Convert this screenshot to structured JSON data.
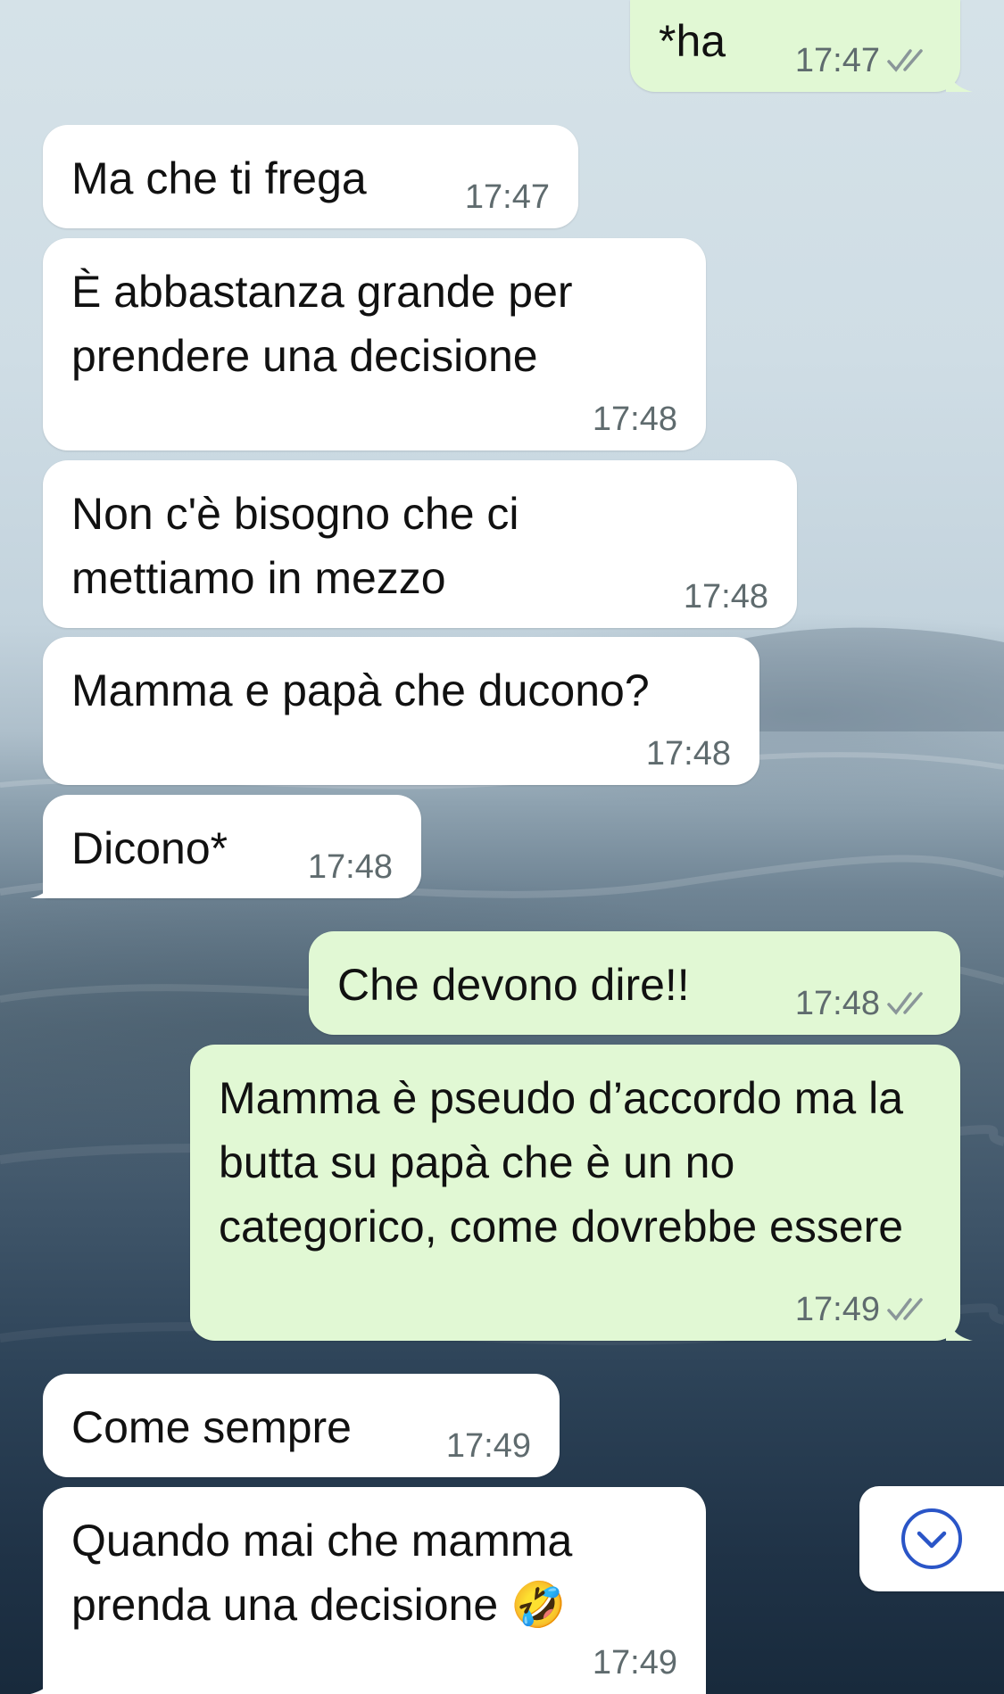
{
  "colors": {
    "incoming_bubble": "#ffffff",
    "outgoing_bubble": "#e1f8d4",
    "timestamp": "#5f6b6e",
    "read_ticks": "#8a9699",
    "scroll_button_icon": "#2a55c7"
  },
  "messages": [
    {
      "direction": "outgoing",
      "text": "*ha",
      "time": "17:47",
      "status": "read"
    },
    {
      "direction": "incoming",
      "text": "Ma che ti frega",
      "time": "17:47"
    },
    {
      "direction": "incoming",
      "text": "È abbastanza grande per prendere una decisione",
      "time": "17:48"
    },
    {
      "direction": "incoming",
      "text": "Non c'è bisogno che ci mettiamo in mezzo",
      "time": "17:48"
    },
    {
      "direction": "incoming",
      "text": "Mamma e papà che ducono?",
      "time": "17:48"
    },
    {
      "direction": "incoming",
      "text": "Dicono*",
      "time": "17:48"
    },
    {
      "direction": "outgoing",
      "text": "Che devono dire!!",
      "time": "17:48",
      "status": "read"
    },
    {
      "direction": "outgoing",
      "text": "Mamma è pseudo d’accordo ma la butta su papà che è un no categorico, come dovrebbe essere",
      "time": "17:49",
      "status": "read"
    },
    {
      "direction": "incoming",
      "text": "Come sempre",
      "time": "17:49"
    },
    {
      "direction": "incoming",
      "text": "Quando mai che mamma prenda una decisione 🤣",
      "time": "17:49"
    }
  ],
  "scroll_button": {
    "icon": "chevron-down-circle-icon"
  }
}
